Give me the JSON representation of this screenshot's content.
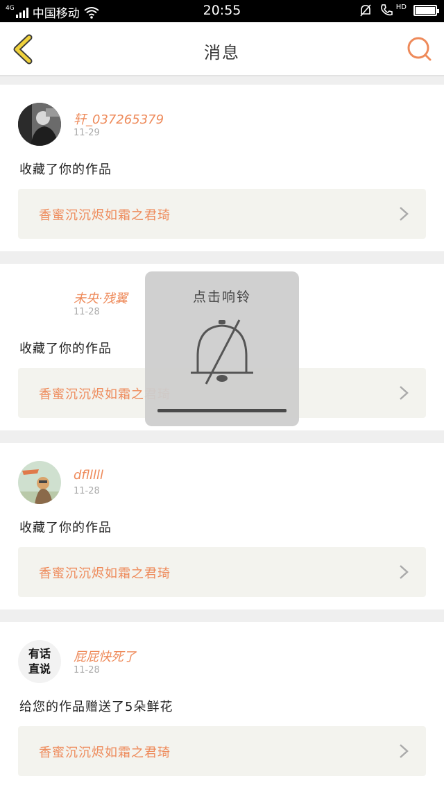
{
  "status_bar": {
    "network_type": "4G",
    "carrier": "中国移动",
    "time": "20:55",
    "hd_label": "HD",
    "icons": [
      "signal-icon",
      "wifi-icon",
      "mute-bell-icon",
      "call-hd-icon",
      "battery-icon"
    ]
  },
  "header": {
    "title": "消息",
    "back_icon": "chevron-left-icon",
    "search_icon": "search-icon"
  },
  "messages": [
    {
      "username": "轩_037265379",
      "date": "11-29",
      "action": "收藏了你的作品",
      "work_title": "香蜜沉沉烬如霜之君琦",
      "avatar": "photo"
    },
    {
      "username": "未央·残翼",
      "date": "11-28",
      "action": "收藏了你的作品",
      "work_title": "香蜜沉沉烬如霜之君琦",
      "avatar": "none"
    },
    {
      "username": "dflllll",
      "date": "11-28",
      "action": "收藏了你的作品",
      "work_title": "香蜜沉沉烬如霜之君琦",
      "avatar": "photo"
    },
    {
      "username": "屁屁快死了",
      "date": "11-28",
      "action": "给您的作品赠送了5朵鲜花",
      "work_title": "香蜜沉沉烬如霜之君琦",
      "avatar": "text",
      "avatar_text": [
        "有话",
        "直说"
      ]
    }
  ],
  "toast": {
    "label": "点击响铃",
    "icon": "bell-muted-icon",
    "volume_level": 0
  },
  "colors": {
    "accent": "#ee8a5a",
    "back_icon": "#f0d23c",
    "status_bar_bg": "#000000",
    "work_bg": "#f3f3ee"
  }
}
